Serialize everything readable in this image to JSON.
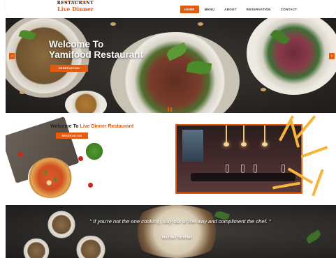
{
  "brand": {
    "logo_top": "RESTAURANT",
    "logo_bottom": "Live Dinner",
    "accent_color": "#e35b0e"
  },
  "nav": {
    "items": [
      {
        "label": "HOME",
        "active": true
      },
      {
        "label": "MENU",
        "active": false
      },
      {
        "label": "ABOUT",
        "active": false
      },
      {
        "label": "RESERVATION",
        "active": false
      },
      {
        "label": "CONTACT",
        "active": false
      }
    ]
  },
  "hero": {
    "title_line1": "Welcome To",
    "title_line2": "Yamifood Restaurant",
    "button_label": "RESERVATION",
    "prev_icon": "chevron-left-icon",
    "next_icon": "chevron-right-icon"
  },
  "about": {
    "title_prefix": "Welcome To",
    "title_highlight": "Live Dinner Restaurant",
    "button_label": "RESERVATION"
  },
  "quote": {
    "text": "\" If you're not the one cooking, stay out of the way and compliment the chef. \"",
    "author": "Michael Strahan"
  }
}
